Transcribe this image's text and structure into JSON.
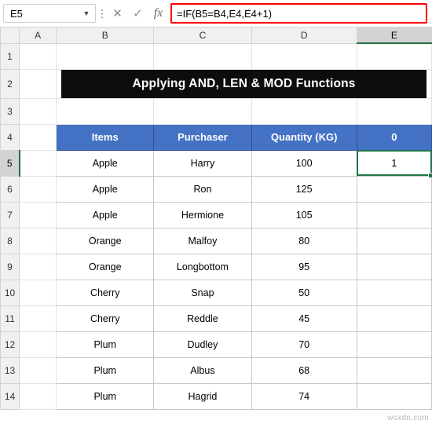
{
  "formula_bar": {
    "name_box_value": "E5",
    "name_box_arrow": "▼",
    "more_icon": "⋮",
    "cancel_icon": "✕",
    "confirm_icon": "✓",
    "fx_icon": "fx",
    "formula_value": "=IF(B5=B4,E4,E4+1)",
    "formula_placeholder": ""
  },
  "grid": {
    "column_headers": [
      "A",
      "B",
      "C",
      "D",
      "E"
    ],
    "active_column": "E",
    "row_headers": [
      "1",
      "2",
      "3",
      "4",
      "5",
      "6",
      "7",
      "8",
      "9",
      "10",
      "11",
      "12",
      "13",
      "14"
    ],
    "active_row": "5",
    "title_banner": "Applying AND, LEN & MOD Functions",
    "table_headers": [
      "Items",
      "Purchaser",
      "Quantity (KG)",
      "0"
    ],
    "rows": [
      {
        "item": "Apple",
        "purchaser": "Harry",
        "quantity": "100",
        "result": "1"
      },
      {
        "item": "Apple",
        "purchaser": "Ron",
        "quantity": "125",
        "result": ""
      },
      {
        "item": "Apple",
        "purchaser": "Hermione",
        "quantity": "105",
        "result": ""
      },
      {
        "item": "Orange",
        "purchaser": "Malfoy",
        "quantity": "80",
        "result": ""
      },
      {
        "item": "Orange",
        "purchaser": "Longbottom",
        "quantity": "95",
        "result": ""
      },
      {
        "item": "Cherry",
        "purchaser": "Snap",
        "quantity": "50",
        "result": ""
      },
      {
        "item": "Cherry",
        "purchaser": "Reddle",
        "quantity": "45",
        "result": ""
      },
      {
        "item": "Plum",
        "purchaser": "Dudley",
        "quantity": "70",
        "result": ""
      },
      {
        "item": "Plum",
        "purchaser": "Albus",
        "quantity": "68",
        "result": ""
      },
      {
        "item": "Plum",
        "purchaser": "Hagrid",
        "quantity": "74",
        "result": ""
      }
    ]
  },
  "watermark": "wsxdn.com",
  "colors": {
    "header_blue": "#4472c4",
    "banner_black": "#0d0d0d",
    "selection_green": "#217346",
    "formula_highlight": "#ff0000"
  }
}
